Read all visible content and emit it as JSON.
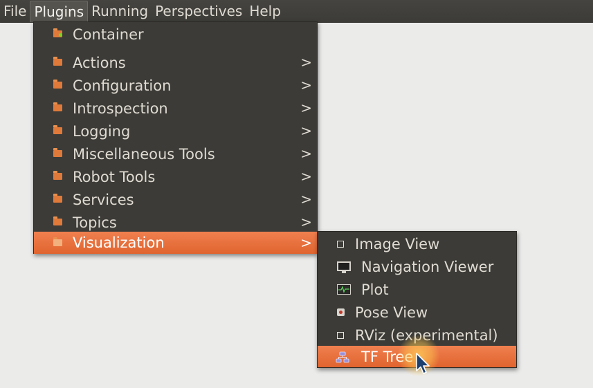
{
  "menubar": {
    "items": [
      {
        "label": "File"
      },
      {
        "label": "Plugins"
      },
      {
        "label": "Running"
      },
      {
        "label": "Perspectives"
      },
      {
        "label": "Help"
      }
    ],
    "active": "Plugins"
  },
  "plugins_menu": {
    "container_label": "Container",
    "items": [
      {
        "label": "Actions",
        "icon": "folder-icon"
      },
      {
        "label": "Configuration",
        "icon": "folder-icon"
      },
      {
        "label": "Introspection",
        "icon": "folder-icon"
      },
      {
        "label": "Logging",
        "icon": "folder-icon"
      },
      {
        "label": "Miscellaneous Tools",
        "icon": "folder-icon"
      },
      {
        "label": "Robot Tools",
        "icon": "folder-icon"
      },
      {
        "label": "Services",
        "icon": "folder-icon"
      },
      {
        "label": "Topics",
        "icon": "folder-icon"
      },
      {
        "label": "Visualization",
        "icon": "folder-open-icon",
        "highlighted": true
      }
    ],
    "submenu_arrow": ">"
  },
  "visualization_submenu": {
    "items": [
      {
        "label": "Image View",
        "icon": "window-icon"
      },
      {
        "label": "Navigation Viewer",
        "icon": "monitor-icon"
      },
      {
        "label": "Plot",
        "icon": "plot-icon"
      },
      {
        "label": "Pose View",
        "icon": "pose-icon"
      },
      {
        "label": "RViz (experimental)",
        "icon": "window-icon"
      },
      {
        "label": "TF Tree",
        "icon": "tf-tree-icon",
        "highlighted": true
      }
    ]
  },
  "colors": {
    "menu_bg": "#3c3b37",
    "highlight": "#e9693a",
    "menu_text": "#dfdbd2",
    "workspace_bg": "#ebebea"
  }
}
